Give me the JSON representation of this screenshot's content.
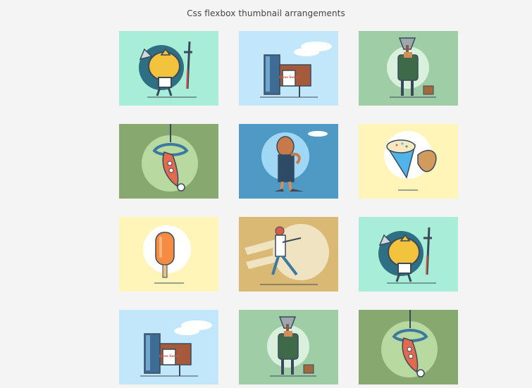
{
  "page": {
    "title": "Css flexbox thumbnail arrangements"
  },
  "thumbnails": [
    {
      "illustration": "knight-icon",
      "bg": "#a8edd8"
    },
    {
      "illustration": "mailbox-icon",
      "bg": "#c2e7fa"
    },
    {
      "illustration": "axe-woodsman-icon",
      "bg": "#9fcea6"
    },
    {
      "illustration": "squid-hook-icon",
      "bg": "#87a96f"
    },
    {
      "illustration": "bald-man-icon",
      "bg": "#4e9ac4"
    },
    {
      "illustration": "ice-cream-cone-icon",
      "bg": "#fff5b9"
    },
    {
      "illustration": "popsicle-icon",
      "bg": "#fff5b9"
    },
    {
      "illustration": "baseball-player-icon",
      "bg": "#d9b974"
    },
    {
      "illustration": "knight-icon",
      "bg": "#a8edd8"
    },
    {
      "illustration": "mailbox-icon",
      "bg": "#c2e7fa"
    },
    {
      "illustration": "axe-woodsman-icon",
      "bg": "#9fcea6"
    },
    {
      "illustration": "squid-hook-icon",
      "bg": "#87a96f"
    }
  ],
  "mailbox": {
    "sign": "Home Sweet"
  },
  "colors": {
    "page_bg": "#f4f4f4",
    "title_text": "#444444",
    "outline": "#3b4a5a"
  }
}
